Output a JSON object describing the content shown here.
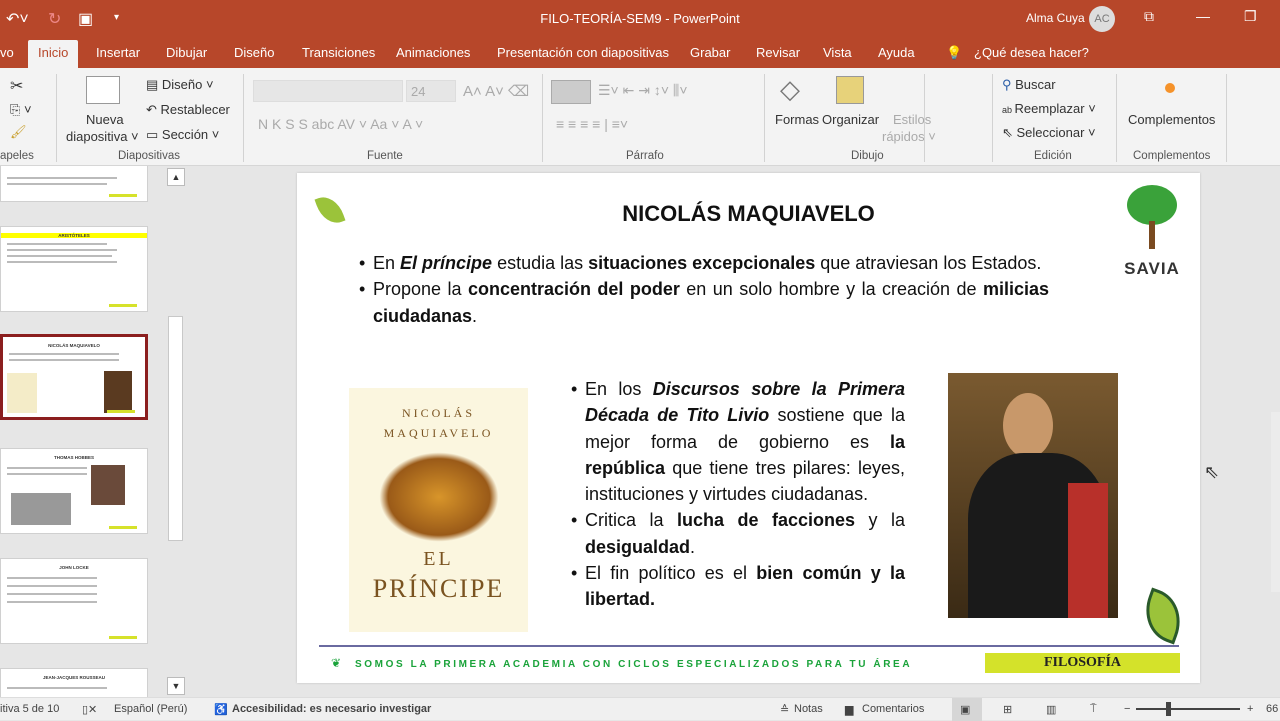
{
  "titlebar": {
    "doc_title": "FILO-TEORÍA-SEM9  -  PowerPoint",
    "user": "Alma Cuya",
    "initials": "AC"
  },
  "tabs": [
    "vo",
    "Inicio",
    "Insertar",
    "Dibujar",
    "Diseño",
    "Transiciones",
    "Animaciones",
    "Presentación con diapositivas",
    "Grabar",
    "Revisar",
    "Vista",
    "Ayuda"
  ],
  "tell_me": "¿Qué desea hacer?",
  "ribbon": {
    "clipboard_group": "apeles",
    "new_slide": "Nueva",
    "new_slide2": "diapositiva ˅",
    "layout": "Diseño ˅",
    "reset": "Restablecer",
    "section": "Sección ˅",
    "slides_group": "Diapositivas",
    "font_size": "24",
    "font_buttons": "N  K  S  S  abc  AV ˅  Aa ˅    A ˅",
    "font_group": "Fuente",
    "paragraph_group": "Párrafo",
    "shapes": "Formas",
    "arrange": "Organizar",
    "quick_styles": "Estilos",
    "quick_styles2": "rápidos ˅",
    "drawing_group": "Dibujo",
    "find": "Buscar",
    "replace": "Reemplazar ˅",
    "select": "Seleccionar ˅",
    "editing_group": "Edición",
    "addins": "Complementos",
    "addins_group": "Complementos"
  },
  "thumbnails": [
    {
      "title": ""
    },
    {
      "title": "ARISTÓTELES"
    },
    {
      "title": "NICOLÁS MAQUIAVELO"
    },
    {
      "title": "THOMAS HOBBES"
    },
    {
      "title": "JOHN LOCKE"
    },
    {
      "title": "JEAN-JACQUES ROUSSEAU"
    }
  ],
  "slide": {
    "title": "NICOLÁS MAQUIAVELO",
    "logo": "SAVIA",
    "book_author1": "NICOLÁS",
    "book_author2": "MAQUIAVELO",
    "book_el": "EL",
    "book_title": "PRÍNCIPE",
    "footer": "SOMOS LA PRIMERA ACADEMIA CON CICLOS ESPECIALIZADOS PARA TU ÁREA",
    "subject": "FILOSOFÍA"
  },
  "status": {
    "slide": "itiva 5 de 10",
    "language": "Español (Perú)",
    "accessibility": "Accesibilidad: es necesario investigar",
    "notes": "Notas",
    "comments": "Comentarios",
    "zoom": "66"
  }
}
